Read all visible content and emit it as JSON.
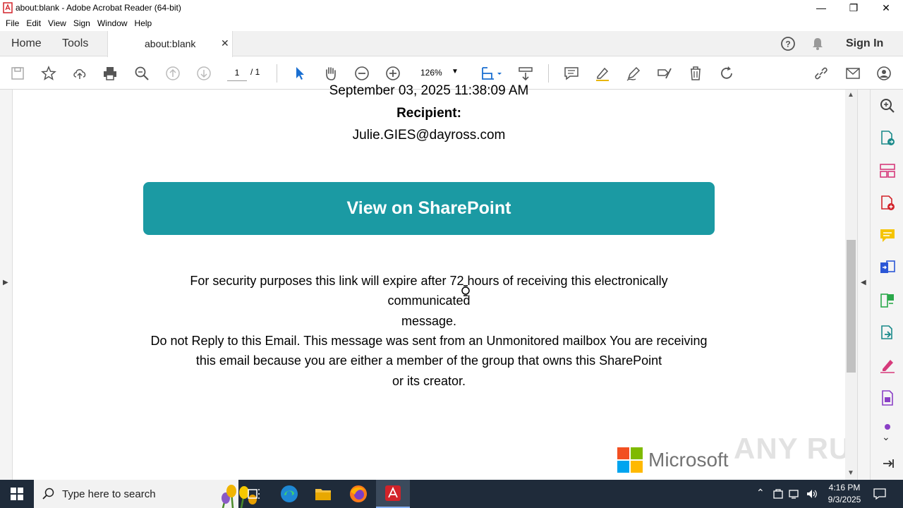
{
  "window": {
    "title": "about:blank - Adobe Acrobat Reader (64-bit)"
  },
  "menu": [
    "File",
    "Edit",
    "View",
    "Sign",
    "Window",
    "Help"
  ],
  "tabs": {
    "home": "Home",
    "tools": "Tools",
    "document": "about:blank",
    "sign_in": "Sign In"
  },
  "toolbar": {
    "page_current": "1",
    "page_total": "/ 1",
    "zoom": "126%"
  },
  "document": {
    "date_line": "September 03, 2025 11:38:09 AM",
    "recipient_label": "Recipient:",
    "recipient_email": "Julie.GIES@dayross.com",
    "button_label": "View on SharePoint",
    "expire_line1": "For security purposes this link will expire after 72 hours of receiving this electronically",
    "expire_line2": "communicated",
    "expire_line3": "message.",
    "reply_line1": "Do not Reply to this Email. This message was sent from an Unmonitored mailbox You are receiving",
    "reply_line2": "this email because you are either a member of the group that owns this SharePoint",
    "reply_line3": "or its creator.",
    "logo_text": "Microsoft"
  },
  "watermark": "ANY RUN",
  "taskbar": {
    "search_placeholder": "Type here to search",
    "time": "4:16 PM",
    "date": "9/3/2025"
  },
  "colors": {
    "accent": "#1b9aa3",
    "acrobat_red": "#d2232a",
    "taskbar": "#1f2b3a"
  }
}
